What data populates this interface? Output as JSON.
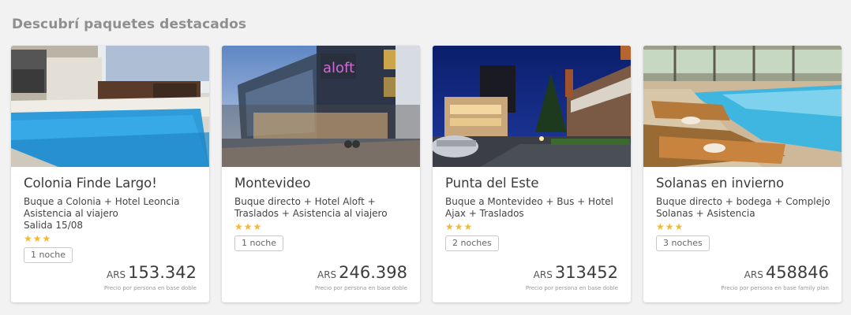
{
  "section": {
    "title": "Descubrí paquetes destacados"
  },
  "colors": {
    "star": "#f5b82e",
    "title": "#8f8f8f",
    "background": "#f2f2f2"
  },
  "cards": [
    {
      "title": "Colonia Finde Largo!",
      "description": "Buque a Colonia + Hotel Leoncia Asistencia al viajero",
      "extra": "Salida 15/08",
      "stars": "★★★",
      "nights": "1 noche",
      "currency": "ARS",
      "price": "153.342",
      "price_note": "Precio por persona en base doble"
    },
    {
      "title": "Montevideo",
      "description": "Buque directo + Hotel Aloft + Traslados + Asistencia al viajero",
      "extra": "",
      "stars": "★★★",
      "nights": "1 noche",
      "currency": "ARS",
      "price": "246.398",
      "price_note": "Precio por persona en base doble"
    },
    {
      "title": "Punta del Este",
      "description": "Buque a Montevideo + Bus + Hotel Ajax + Traslados",
      "extra": "",
      "stars": "★★★",
      "nights": "2 noches",
      "currency": "ARS",
      "price": "313452",
      "price_note": "Precio por persona en base doble"
    },
    {
      "title": "Solanas en invierno",
      "description": "Buque directo + bodega + Complejo Solanas + Asistencia",
      "extra": "",
      "stars": "★★★",
      "nights": "3 noches",
      "currency": "ARS",
      "price": "458846",
      "price_note": "Precio por persona en base family plan"
    }
  ]
}
